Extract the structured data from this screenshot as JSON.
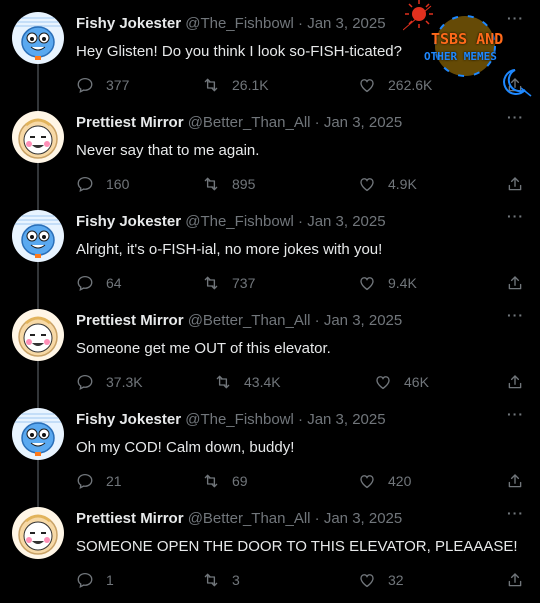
{
  "watermark": {
    "title": "TSBS AND",
    "subtitle": "OTHER MEMES"
  },
  "tweets": [
    {
      "author": "fishy",
      "name": "Fishy Jokester",
      "handle": "@The_Fishbowl",
      "date": "Jan 3, 2025",
      "text": "Hey Glisten! Do you think I look so-FISH-ticated?",
      "replies": "377",
      "retweets": "26.1K",
      "likes": "262.6K"
    },
    {
      "author": "mirror",
      "name": "Prettiest Mirror",
      "handle": "@Better_Than_All",
      "date": "Jan 3, 2025",
      "text": "Never say that to me again.",
      "replies": "160",
      "retweets": "895",
      "likes": "4.9K"
    },
    {
      "author": "fishy",
      "name": "Fishy Jokester",
      "handle": "@The_Fishbowl",
      "date": "Jan 3, 2025",
      "text": "Alright, it's o-FISH-ial, no more jokes with you!",
      "replies": "64",
      "retweets": "737",
      "likes": "9.4K"
    },
    {
      "author": "mirror",
      "name": "Prettiest Mirror",
      "handle": "@Better_Than_All",
      "date": "Jan 3, 2025",
      "text": "Someone get me OUT of this elevator.",
      "replies": "37.3K",
      "retweets": "43.4K",
      "likes": "46K"
    },
    {
      "author": "fishy",
      "name": "Fishy Jokester",
      "handle": "@The_Fishbowl",
      "date": "Jan 3, 2025",
      "text": "Oh my COD! Calm down, buddy!",
      "replies": "21",
      "retweets": "69",
      "likes": "420"
    },
    {
      "author": "mirror",
      "name": "Prettiest Mirror",
      "handle": "@Better_Than_All",
      "date": "Jan 3, 2025",
      "text": "SOMEONE OPEN THE DOOR TO THIS ELEVATOR, PLEAAASE!",
      "replies": "1",
      "retweets": "3",
      "likes": "32"
    }
  ]
}
